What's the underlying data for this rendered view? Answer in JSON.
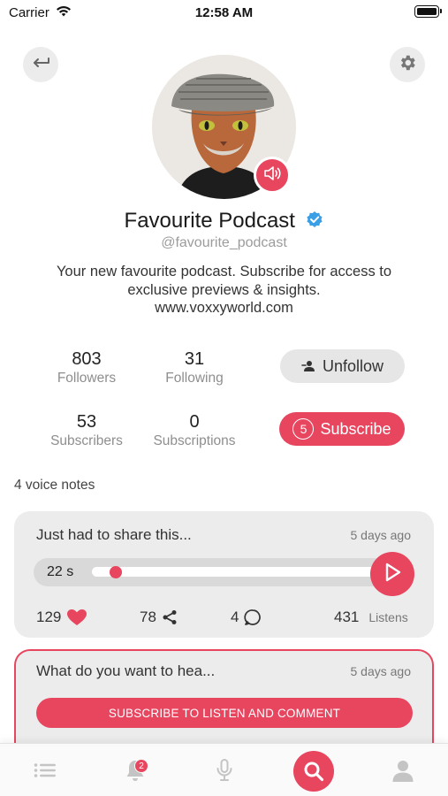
{
  "status_bar": {
    "carrier": "Carrier",
    "time": "12:58 AM"
  },
  "profile": {
    "name": "Favourite Podcast",
    "handle": "@favourite_podcast",
    "bio_line1": "Your new favourite podcast. Subscribe for access to",
    "bio_line2": "exclusive previews & insights.",
    "bio_line3": "www.voxxyworld.com",
    "verified": true
  },
  "stats": {
    "followers": {
      "value": "803",
      "label": "Followers"
    },
    "following": {
      "value": "31",
      "label": "Following"
    },
    "subscribers": {
      "value": "53",
      "label": "Subscribers"
    },
    "subscriptions": {
      "value": "0",
      "label": "Subscriptions"
    }
  },
  "actions": {
    "unfollow_label": "Unfollow",
    "subscribe_label": "Subscribe",
    "subscribe_count": "5"
  },
  "voice_notes_count": "4 voice notes",
  "cards": [
    {
      "title": "Just had to share this...",
      "time": "5 days ago",
      "duration": "22 s",
      "progress": 0.0,
      "likes": "129",
      "shares": "78",
      "comments": "4",
      "listens": "431",
      "listens_label": "Listens"
    },
    {
      "title": "What do you want to hea...",
      "time": "5 days ago",
      "button_label": "SUBSCRIBE TO LISTEN AND COMMENT"
    }
  ],
  "tab_bar": {
    "notifications_badge": "2",
    "items": [
      "list-icon",
      "bell-icon",
      "microphone-icon",
      "search-icon",
      "profile-icon"
    ],
    "active": "search-icon"
  },
  "colors": {
    "accent": "#e8455f",
    "card_bg": "#ececec",
    "verified": "#3b9fe6"
  }
}
